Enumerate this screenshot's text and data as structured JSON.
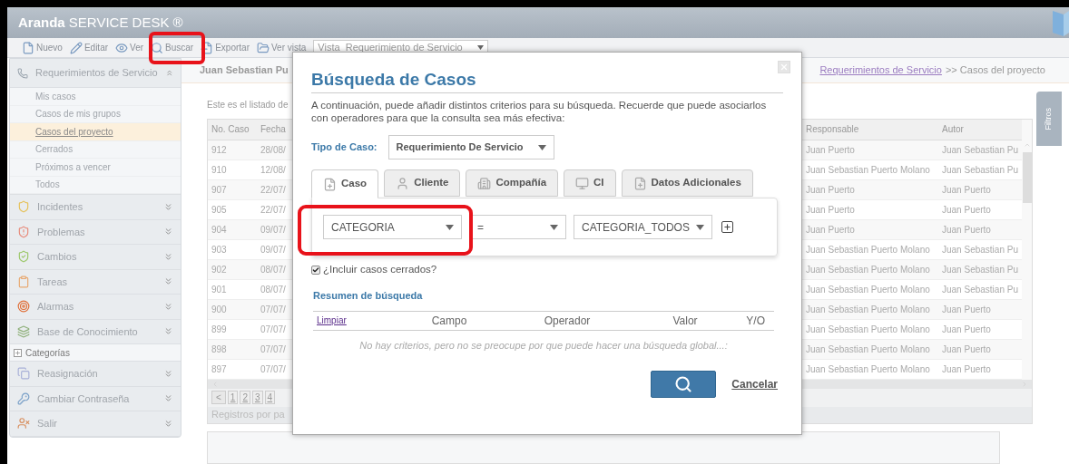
{
  "app": {
    "logo_bold": "Aranda",
    "logo_rest": "SERVICE DESK ®"
  },
  "toolbar": {
    "buttons": [
      {
        "label": "Nuevo"
      },
      {
        "label": "Editar"
      },
      {
        "label": "Ver"
      },
      {
        "label": "Buscar"
      },
      {
        "label": "Exportar"
      },
      {
        "label": "Ver vista"
      }
    ],
    "view_select": "Vista  Requerimiento de Servicio"
  },
  "sidebar": {
    "sections": [
      {
        "kind": "section",
        "label": "Requerimientos de Servicio",
        "expanded": true,
        "items": [
          {
            "label": "Mis casos",
            "selected": false
          },
          {
            "label": "Casos de mis grupos",
            "selected": false
          },
          {
            "label": "Casos del proyecto",
            "selected": true
          },
          {
            "label": "Cerrados",
            "selected": false
          },
          {
            "label": "Próximos a vencer",
            "selected": false
          },
          {
            "label": "Todos",
            "selected": false
          }
        ]
      },
      {
        "kind": "section",
        "label": "Incidentes",
        "expanded": false
      },
      {
        "kind": "section",
        "label": "Problemas",
        "expanded": false
      },
      {
        "kind": "section",
        "label": "Cambios",
        "expanded": false
      },
      {
        "kind": "section",
        "label": "Tareas",
        "expanded": false
      },
      {
        "kind": "section",
        "label": "Alarmas",
        "expanded": false
      },
      {
        "kind": "section",
        "label": "Base de Conocimiento",
        "expanded": false
      },
      {
        "kind": "tree",
        "label": "Categorías",
        "expanded": false
      },
      {
        "kind": "section",
        "label": "Reasignación",
        "expanded": false
      },
      {
        "kind": "section",
        "label": "Cambiar Contraseña",
        "expanded": false
      },
      {
        "kind": "section",
        "label": "Salir",
        "expanded": false
      }
    ]
  },
  "breadcrumb": {
    "user": "Juan Sebastian Pu",
    "link": "Requerimientos de Servicio",
    "rest": ">> Casos del proyecto"
  },
  "intro": "Este es el listado de",
  "table": {
    "columns": [
      "No. Caso",
      "Fecha",
      "Responsable",
      "Autor"
    ],
    "rows": [
      {
        "no": "912",
        "date": "28/08/",
        "resp": "Juan Puerto",
        "author": "Juan Sebastian Pu"
      },
      {
        "no": "910",
        "date": "12/08/",
        "resp": "Juan Sebastian Puerto Molano",
        "author": "Juan Sebastian Pu"
      },
      {
        "no": "907",
        "date": "22/07/",
        "resp": "Juan Puerto",
        "author": "Juan Puerto"
      },
      {
        "no": "905",
        "date": "22/07/",
        "resp": "Juan Puerto",
        "author": "Juan Puerto"
      },
      {
        "no": "904",
        "date": "09/07/",
        "resp": "Juan Puerto",
        "author": "Juan Puerto"
      },
      {
        "no": "903",
        "date": "09/07/",
        "resp": "Juan Sebastian Puerto Molano",
        "author": "Juan Sebastian Pu"
      },
      {
        "no": "902",
        "date": "08/07/",
        "resp": "Juan Sebastian Puerto Molano",
        "author": "Juan Sebastian Pu"
      },
      {
        "no": "901",
        "date": "08/07/",
        "resp": "Juan Sebastian Puerto Molano",
        "author": "Juan Sebastian Pu"
      },
      {
        "no": "900",
        "date": "07/07/",
        "resp": "Juan Sebastian Puerto Molano",
        "author": "Juan Puerto"
      },
      {
        "no": "899",
        "date": "07/07/",
        "resp": "Juan Sebastian Puerto Molano",
        "author": "Juan Puerto"
      },
      {
        "no": "898",
        "date": "07/07/",
        "resp": "Juan Sebastian Puerto Molano",
        "author": "Juan Puerto"
      },
      {
        "no": "897",
        "date": "07/07/",
        "resp": "Juan Sebastian Puerto Molano",
        "author": "Juan Puerto"
      }
    ]
  },
  "pager": {
    "prev": "<",
    "pages": [
      "1",
      "2",
      "3",
      "4"
    ],
    "per_page": "Registros por pa"
  },
  "filters_tab": "Filtros",
  "dialog": {
    "title": "Búsqueda de Casos",
    "description": "A continuación, puede añadir distintos criterios para su búsqueda. Recuerde que puede asociarlos con operadores para que la consulta sea más efectiva:",
    "case_type_label": "Tipo de Caso:",
    "case_type": "Requerimiento De Servicio",
    "tabs": [
      {
        "label": "Caso",
        "selected": true
      },
      {
        "label": "Cliente",
        "selected": false
      },
      {
        "label": "Compañía",
        "selected": false
      },
      {
        "label": "CI",
        "selected": false
      },
      {
        "label": "Datos Adicionales",
        "selected": false
      }
    ],
    "criteria": {
      "field": "CATEGORIA",
      "operator": "=",
      "value": "CATEGORIA_TODOS"
    },
    "include_closed": {
      "label": "¿Incluir casos cerrados?",
      "checked": true
    },
    "summary_title": "Resumen de búsqueda",
    "summary_columns": [
      "Limpiar",
      "Campo",
      "Operador",
      "Valor",
      "Y/O"
    ],
    "empty_message": "No hay criterios, pero no se preocupe por que puede hacer una búsqueda global...:",
    "cancel": "Cancelar"
  }
}
